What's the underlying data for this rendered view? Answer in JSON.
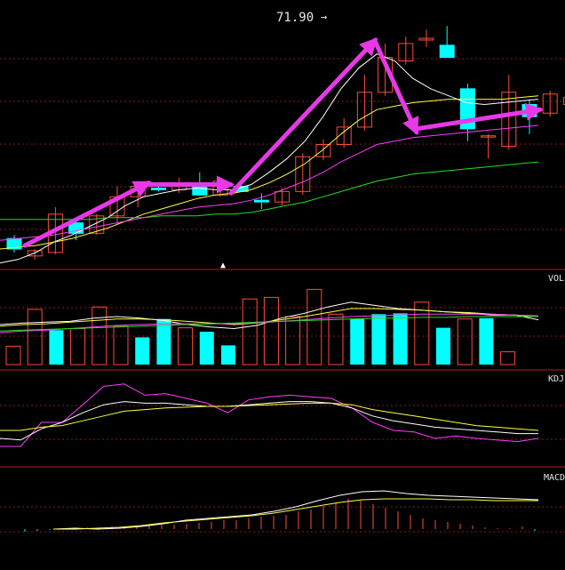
{
  "colors": {
    "background": "#000000",
    "grid": "#8a1c1c",
    "divider": "#b02020",
    "up": "#ff4a3a",
    "down": "#00ffff",
    "ma_white": "#ffffff",
    "ma_yellow": "#ffff40",
    "ma_magenta": "#ff3cff",
    "ma_green": "#20e020",
    "arrow": "#e838e8",
    "label": "#e8e8e8"
  },
  "annotations": {
    "peak_label": "71.90",
    "peak_pointer": "→",
    "date_marker": "▲"
  },
  "chart_data": [
    {
      "type": "candlestick",
      "panel": "price",
      "grid": true,
      "candles": [
        {
          "o": 26.0,
          "h": 28.0,
          "l": 18.0,
          "c": 20.0
        },
        {
          "o": 16.0,
          "h": 20.0,
          "l": 14.0,
          "c": 19.0
        },
        {
          "o": 18.0,
          "h": 44.0,
          "l": 17.0,
          "c": 40.0
        },
        {
          "o": 35.0,
          "h": 37.0,
          "l": 25.0,
          "c": 29.0
        },
        {
          "o": 29.0,
          "h": 40.0,
          "l": 28.0,
          "c": 39.0
        },
        {
          "o": 39.0,
          "h": 56.0,
          "l": 34.0,
          "c": 50.0
        },
        {
          "o": 50.0,
          "h": 58.0,
          "l": 44.0,
          "c": 56.0
        },
        {
          "o": 55.0,
          "h": 57.0,
          "l": 53.0,
          "c": 54.0
        },
        {
          "o": 54.0,
          "h": 61.0,
          "l": 52.0,
          "c": 57.0
        },
        {
          "o": 57.0,
          "h": 64.0,
          "l": 51.0,
          "c": 51.0
        },
        {
          "o": 51.0,
          "h": 61.0,
          "l": 50.0,
          "c": 59.0
        },
        {
          "o": 56.0,
          "h": 58.0,
          "l": 53.0,
          "c": 53.0
        },
        {
          "o": 48.0,
          "h": 52.0,
          "l": 43.0,
          "c": 47.0
        },
        {
          "o": 47.0,
          "h": 55.0,
          "l": 45.0,
          "c": 53.0
        },
        {
          "o": 53.0,
          "h": 75.0,
          "l": 51.0,
          "c": 73.0
        },
        {
          "o": 73.0,
          "h": 83.0,
          "l": 71.0,
          "c": 80.0
        },
        {
          "o": 80.0,
          "h": 95.0,
          "l": 78.0,
          "c": 90.0
        },
        {
          "o": 90.0,
          "h": 120.0,
          "l": 88.0,
          "c": 110.0
        },
        {
          "o": 110.0,
          "h": 138.0,
          "l": 108.0,
          "c": 130.0
        },
        {
          "o": 128.0,
          "h": 142.0,
          "l": 126.0,
          "c": 138.0
        },
        {
          "o": 140.0,
          "h": 146.0,
          "l": 136.0,
          "c": 141.0
        },
        {
          "o": 137.0,
          "h": 148.0,
          "l": 132.0,
          "c": 130.0
        },
        {
          "o": 112.0,
          "h": 115.0,
          "l": 82.0,
          "c": 89.0
        },
        {
          "o": 85.0,
          "h": 86.0,
          "l": 72.0,
          "c": 85.0
        },
        {
          "o": 79.0,
          "h": 120.0,
          "l": 77.0,
          "c": 110.0
        },
        {
          "o": 103.0,
          "h": 106.0,
          "l": 86.0,
          "c": 96.0
        },
        {
          "o": 98.0,
          "h": 111.0,
          "l": 96.0,
          "c": 109.0
        },
        {
          "o": 103.0,
          "h": 112.0,
          "l": 99.0,
          "c": 107.0
        },
        {
          "o": 106.0,
          "h": 115.0,
          "l": 104.0,
          "c": 113.0
        },
        {
          "o": 116.0,
          "h": 125.0,
          "l": 100.0,
          "c": 100.0
        },
        {
          "o": 92.0,
          "h": 112.0,
          "l": 90.0,
          "c": 106.0
        }
      ],
      "moving_averages": [
        {
          "color": "ma_white",
          "values": [
            12,
            14,
            18,
            24,
            28,
            33,
            38,
            45,
            50,
            52,
            54,
            55,
            54,
            54,
            57,
            64,
            72,
            82,
            96,
            112,
            124,
            132,
            128,
            118,
            112,
            108,
            104,
            103,
            104,
            105,
            106
          ]
        },
        {
          "color": "ma_yellow",
          "values": [
            20,
            21,
            22,
            24,
            26,
            29,
            32,
            36,
            40,
            43,
            46,
            49,
            51,
            52,
            54,
            58,
            63,
            69,
            77,
            86,
            94,
            100,
            102,
            104,
            105,
            106,
            106,
            106,
            106,
            107,
            108
          ]
        },
        {
          "color": "ma_magenta",
          "values": [
            25,
            26,
            27,
            28,
            30,
            32,
            34,
            36,
            38,
            40,
            42,
            44,
            45,
            46,
            48,
            51,
            55,
            59,
            64,
            70,
            75,
            80,
            82,
            84,
            85,
            86,
            87,
            88,
            89,
            90,
            91
          ]
        },
        {
          "color": "ma_green",
          "values": [
            37,
            37,
            37,
            37,
            37,
            37,
            38,
            38,
            38,
            39,
            39,
            39,
            40,
            40,
            41,
            43,
            45,
            47,
            50,
            53,
            56,
            59,
            61,
            63,
            64,
            65,
            66,
            67,
            68,
            69,
            70
          ]
        }
      ],
      "arrows": [
        {
          "from": [
            0,
            22
          ],
          "to": [
            6,
            58
          ]
        },
        {
          "from": [
            6,
            57
          ],
          "to": [
            10,
            57
          ]
        },
        {
          "from": [
            10,
            52
          ],
          "to": [
            17,
            140
          ]
        },
        {
          "from": [
            17,
            139
          ],
          "to": [
            19,
            87
          ]
        },
        {
          "from": [
            19,
            89
          ],
          "to": [
            25,
            100
          ]
        }
      ]
    },
    {
      "type": "bar",
      "panel": "volume",
      "label": "VOL",
      "grid": true,
      "bars": [
        {
          "v": 23,
          "dir": "up"
        },
        {
          "v": 69,
          "dir": "up"
        },
        {
          "v": 43,
          "dir": "down"
        },
        {
          "v": 45,
          "dir": "up"
        },
        {
          "v": 72,
          "dir": "up"
        },
        {
          "v": 48,
          "dir": "up"
        },
        {
          "v": 34,
          "dir": "down"
        },
        {
          "v": 57,
          "dir": "down"
        },
        {
          "v": 46,
          "dir": "up"
        },
        {
          "v": 41,
          "dir": "down"
        },
        {
          "v": 24,
          "dir": "down"
        },
        {
          "v": 82,
          "dir": "up"
        },
        {
          "v": 84,
          "dir": "up"
        },
        {
          "v": 60,
          "dir": "up"
        },
        {
          "v": 94,
          "dir": "up"
        },
        {
          "v": 63,
          "dir": "up"
        },
        {
          "v": 57,
          "dir": "down"
        },
        {
          "v": 63,
          "dir": "down"
        },
        {
          "v": 64,
          "dir": "down"
        },
        {
          "v": 78,
          "dir": "up"
        },
        {
          "v": 46,
          "dir": "down"
        },
        {
          "v": 57,
          "dir": "up"
        },
        {
          "v": 58,
          "dir": "down"
        },
        {
          "v": 16,
          "dir": "up"
        }
      ],
      "lines": [
        {
          "color": "ma_white",
          "values": [
            50,
            52,
            53,
            54,
            58,
            60,
            58,
            55,
            50,
            47,
            45,
            49,
            58,
            64,
            72,
            78,
            74,
            70,
            68,
            66,
            64,
            62,
            62,
            56
          ]
        },
        {
          "color": "ma_yellow",
          "values": [
            48,
            50,
            51,
            53,
            55,
            57,
            57,
            56,
            54,
            52,
            50,
            52,
            56,
            60,
            65,
            70,
            70,
            69,
            68,
            66,
            65,
            63,
            62,
            60
          ]
        },
        {
          "color": "ma_magenta",
          "values": [
            40,
            42,
            43,
            45,
            47,
            49,
            50,
            51,
            51,
            51,
            51,
            52,
            54,
            56,
            58,
            60,
            61,
            62,
            63,
            63,
            63,
            63,
            62,
            61
          ]
        },
        {
          "color": "ma_green",
          "values": [
            42,
            43,
            44,
            45,
            46,
            47,
            48,
            49,
            50,
            51,
            52,
            53,
            54,
            55,
            56,
            57,
            58,
            58,
            59,
            59,
            60,
            60,
            60,
            60
          ]
        }
      ]
    },
    {
      "type": "line",
      "panel": "oscillator",
      "label": "KDJ",
      "grid": true,
      "lines": [
        {
          "color": "ma_magenta",
          "values": [
            20,
            20,
            50,
            50,
            72,
            95,
            98,
            84,
            86,
            80,
            74,
            62,
            78,
            82,
            84,
            82,
            80,
            68,
            50,
            40,
            38,
            30,
            33,
            30,
            28,
            26,
            30
          ]
        },
        {
          "color": "ma_white",
          "values": [
            30,
            28,
            42,
            50,
            62,
            72,
            76,
            74,
            74,
            72,
            70,
            70,
            72,
            74,
            76,
            76,
            74,
            68,
            58,
            52,
            48,
            44,
            42,
            40,
            38,
            36,
            36
          ]
        },
        {
          "color": "ma_yellow",
          "values": [
            40,
            40,
            44,
            46,
            52,
            58,
            64,
            66,
            68,
            69,
            70,
            70,
            71,
            72,
            73,
            74,
            74,
            72,
            66,
            62,
            58,
            54,
            50,
            46,
            44,
            42,
            40
          ]
        }
      ]
    },
    {
      "type": "bar",
      "panel": "macd",
      "label": "MACD",
      "grid": true,
      "histogram": [
        0.0,
        -0.03,
        -0.02,
        -0.01,
        0.0,
        0.01,
        0.02,
        0.02,
        0.03,
        0.03,
        0.04,
        0.04,
        0.05,
        0.05,
        0.06,
        0.07,
        0.08,
        0.1,
        0.1,
        0.12,
        0.14,
        0.15,
        0.16,
        0.2,
        0.22,
        0.26,
        0.3,
        0.34,
        0.32,
        0.28,
        0.24,
        0.2,
        0.16,
        0.12,
        0.1,
        0.08,
        0.06,
        0.04,
        0.02,
        0.01,
        0.01,
        0.03,
        -0.02
      ],
      "lines": [
        {
          "color": "ma_white",
          "values": [
            0.0,
            0.01,
            0.0,
            0.01,
            0.03,
            0.06,
            0.1,
            0.12,
            0.14,
            0.16,
            0.2,
            0.25,
            0.32,
            0.38,
            0.42,
            0.43,
            0.4,
            0.38,
            0.37,
            0.36,
            0.35,
            0.34,
            0.33
          ]
        },
        {
          "color": "ma_yellow",
          "values": [
            0.0,
            0.0,
            0.01,
            0.02,
            0.04,
            0.07,
            0.09,
            0.11,
            0.13,
            0.15,
            0.18,
            0.22,
            0.26,
            0.3,
            0.33,
            0.34,
            0.34,
            0.34,
            0.33,
            0.33,
            0.32,
            0.32,
            0.32
          ]
        }
      ]
    }
  ]
}
